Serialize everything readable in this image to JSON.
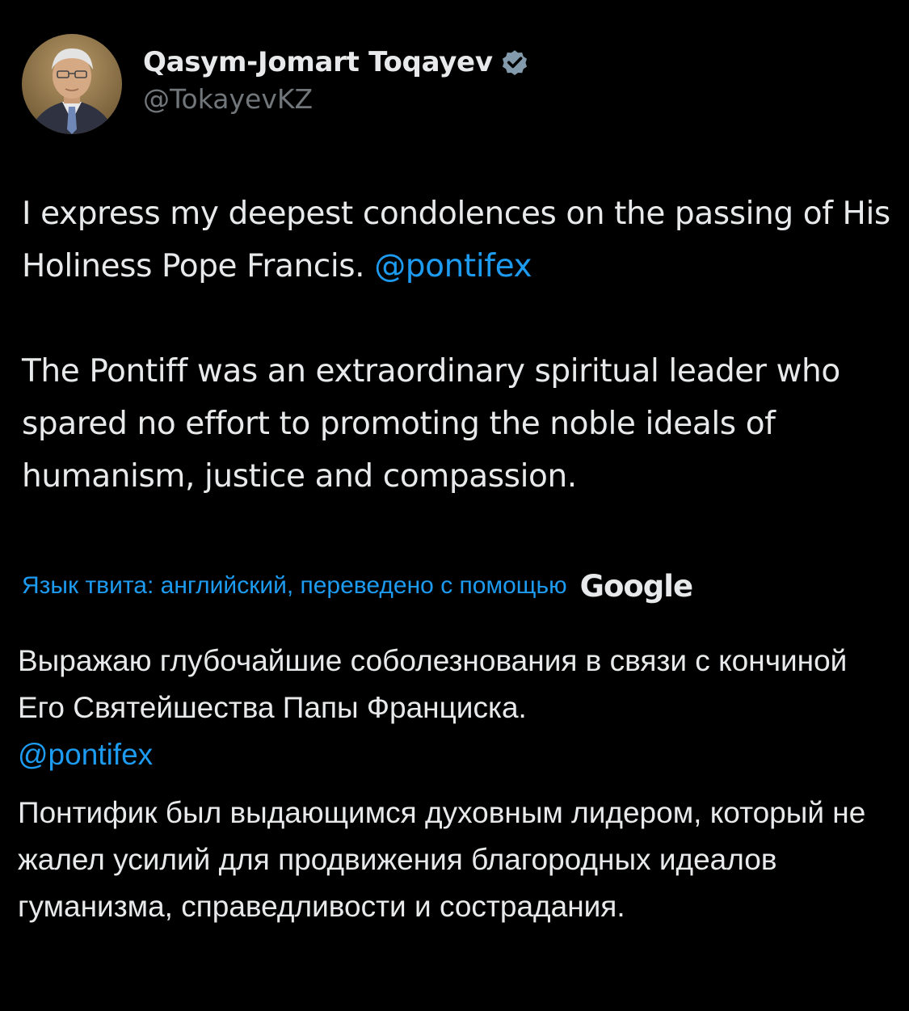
{
  "author": {
    "display_name": "Qasym-Jomart Toqayev",
    "handle": "@TokayevKZ",
    "verified_icon": "verified-badge-icon",
    "avatar": "profile-photo"
  },
  "tweet": {
    "paragraph1_text": "I express my deepest condolences on the passing of His Holiness Pope Francis. ",
    "paragraph1_mention": "@pontifex",
    "paragraph2_text": "The Pontiff was an extraordinary spiritual leader who spared no effort to promoting the noble ideals of humanism, justice and compassion."
  },
  "translation": {
    "note": "Язык твита: английский, переведено с помощью",
    "provider": "Google",
    "paragraph1_text": "Выражаю глубочайшие соболезнования в связи с кончиной Его Святейшества Папы Франциска.",
    "paragraph1_mention": "@pontifex",
    "paragraph2_text": "Понтифик был выдающимся духовным лидером, который не жалел усилий для продвижения благородных идеалов гуманизма, справедливости и сострадания."
  },
  "colors": {
    "background": "#000000",
    "text": "#e7e9ea",
    "secondary_text": "#71767b",
    "link": "#1d9bf0"
  }
}
